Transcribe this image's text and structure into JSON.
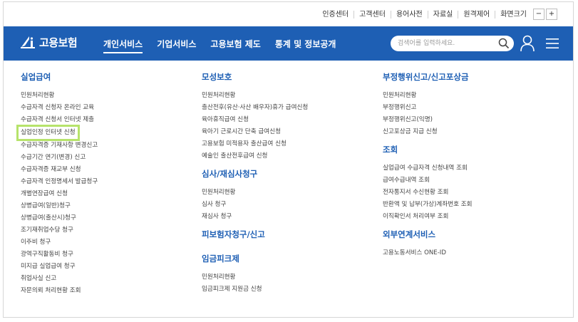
{
  "top_links": [
    "인증센터",
    "고객센터",
    "용어사전",
    "자료실",
    "원격제어",
    "화면크기"
  ],
  "font_size_controls": {
    "minus": "−",
    "plus": "+"
  },
  "logo": {
    "text": "고용보험"
  },
  "nav_menu": [
    {
      "label": "개인서비스",
      "active": true
    },
    {
      "label": "기업서비스",
      "active": false
    },
    {
      "label": "고용보험 제도",
      "active": false
    },
    {
      "label": "통계 및 정보공개",
      "active": false
    }
  ],
  "search": {
    "placeholder": "검색어를 입력하세요."
  },
  "columns": [
    {
      "sections": [
        {
          "title": "실업급여",
          "items": [
            "민원처리현황",
            "수급자격 신청자 온라인 교육",
            "수급자격 신청서 인터넷 제출",
            "실업인정 인터넷 신청",
            "수급자격증 기재사항 변경신고",
            "수급기간 연기(변경) 신고",
            "수급자격증 재교부 신청",
            "수급자격 인정명세서 발급청구",
            "개별연장급여 신청",
            "상병급여(일반)청구",
            "상병급여(출산시)청구",
            "조기재취업수당 청구",
            "이주비 청구",
            "광역구직활동비 청구",
            "미지급 실업급여 청구",
            "취업사실 신고",
            "자문의뢰 처리현황 조회"
          ],
          "highlighted_index": 3
        }
      ]
    },
    {
      "sections": [
        {
          "title": "모성보호",
          "items": [
            "민원처리현황",
            "출산전후(유산·사산 배우자)휴가 급여신청",
            "육아휴직급여 신청",
            "육아기 근로시간 단축 급여신청",
            "고용보험 미적용자 출산급여 신청",
            "예술인 출산전후급여 신청"
          ]
        },
        {
          "title": "심사/재심사청구",
          "items": [
            "민원처리현황",
            "심사 청구",
            "재심사 청구"
          ]
        },
        {
          "title": "피보험자청구/신고",
          "items": []
        },
        {
          "title": "임금피크제",
          "items": [
            "민원처리현황",
            "임금피크제 지원금 신청"
          ]
        }
      ]
    },
    {
      "sections": [
        {
          "title": "부정행위신고/신고포상금",
          "items": [
            "민원처리현황",
            "부정행위신고",
            "부정행위신고(익명)",
            "신고포상금 지급 신청"
          ]
        },
        {
          "title": "조회",
          "items": [
            "실업급여 수급자격 신청내역 조회",
            "급여수급내역 조회",
            "전자통지서 수신현황 조회",
            "반환액 및 납부(가상)계좌번호 조회",
            "이직확인서 처리여부 조회"
          ]
        },
        {
          "title": "외부연계서비스",
          "items": [
            "고용노동서비스 ONE-ID"
          ]
        }
      ]
    }
  ],
  "colors": {
    "brand_blue": "#1e5fb4",
    "highlight_green": "#b6e36b"
  }
}
